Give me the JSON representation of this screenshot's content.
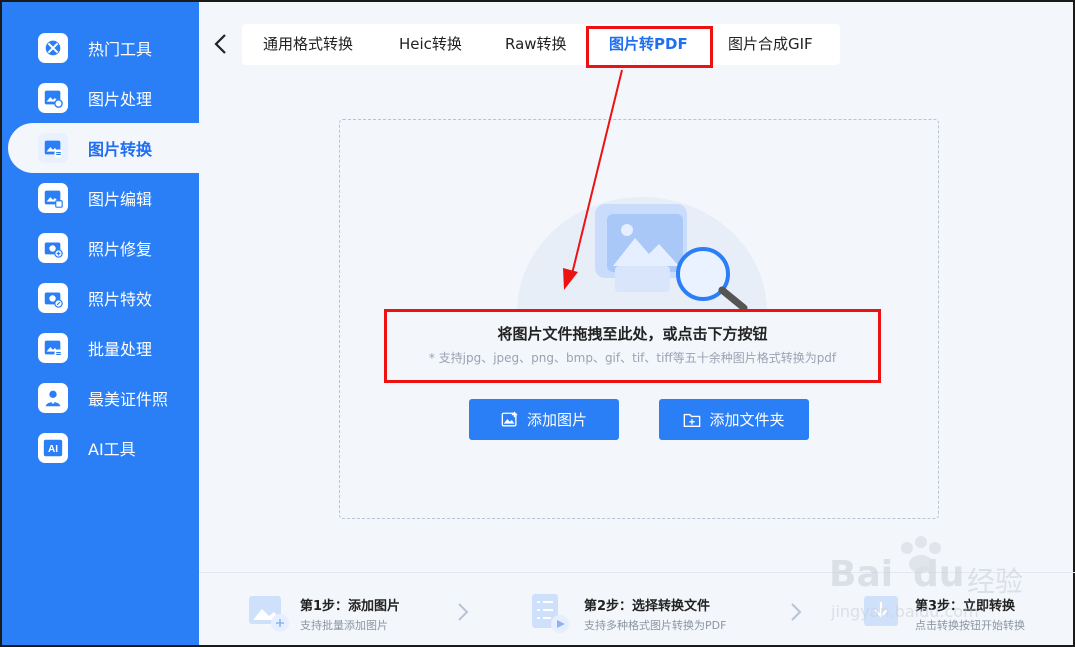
{
  "sidebar": {
    "items": [
      {
        "label": "热门工具",
        "icon": "tools-icon"
      },
      {
        "label": "图片处理",
        "icon": "image-process-icon"
      },
      {
        "label": "图片转换",
        "icon": "image-convert-icon",
        "active": true
      },
      {
        "label": "图片编辑",
        "icon": "image-edit-icon"
      },
      {
        "label": "照片修复",
        "icon": "photo-repair-icon"
      },
      {
        "label": "照片特效",
        "icon": "photo-effect-icon"
      },
      {
        "label": "批量处理",
        "icon": "batch-icon"
      },
      {
        "label": "最美证件照",
        "icon": "id-photo-icon"
      },
      {
        "label": "AI工具",
        "icon": "ai-icon"
      }
    ]
  },
  "tabs": [
    {
      "label": "通用格式转换"
    },
    {
      "label": "Heic转换"
    },
    {
      "label": "Raw转换"
    },
    {
      "label": "图片转PDF",
      "active": true
    },
    {
      "label": "图片合成GIF"
    }
  ],
  "dropzone": {
    "title": "将图片文件拖拽至此处，或点击下方按钮",
    "hint": "* 支持jpg、jpeg、png、bmp、gif、tif、tiff等五十余种图片格式转换为pdf",
    "add_image_label": "添加图片",
    "add_folder_label": "添加文件夹"
  },
  "steps": [
    {
      "title": "第1步：添加图片",
      "desc": "支持批量添加图片"
    },
    {
      "title": "第2步：选择转换文件",
      "desc": "支持多种格式图片转换为PDF"
    },
    {
      "title": "第3步：立即转换",
      "desc": "点击转换按钮开始转换"
    }
  ],
  "watermark": {
    "brand": "Bai",
    "brand2": "du",
    "brand_cn": "经验",
    "url": "jingyan.baidu.com"
  },
  "colors": {
    "accent": "#2a7ef6",
    "annotation": "#e11111"
  }
}
